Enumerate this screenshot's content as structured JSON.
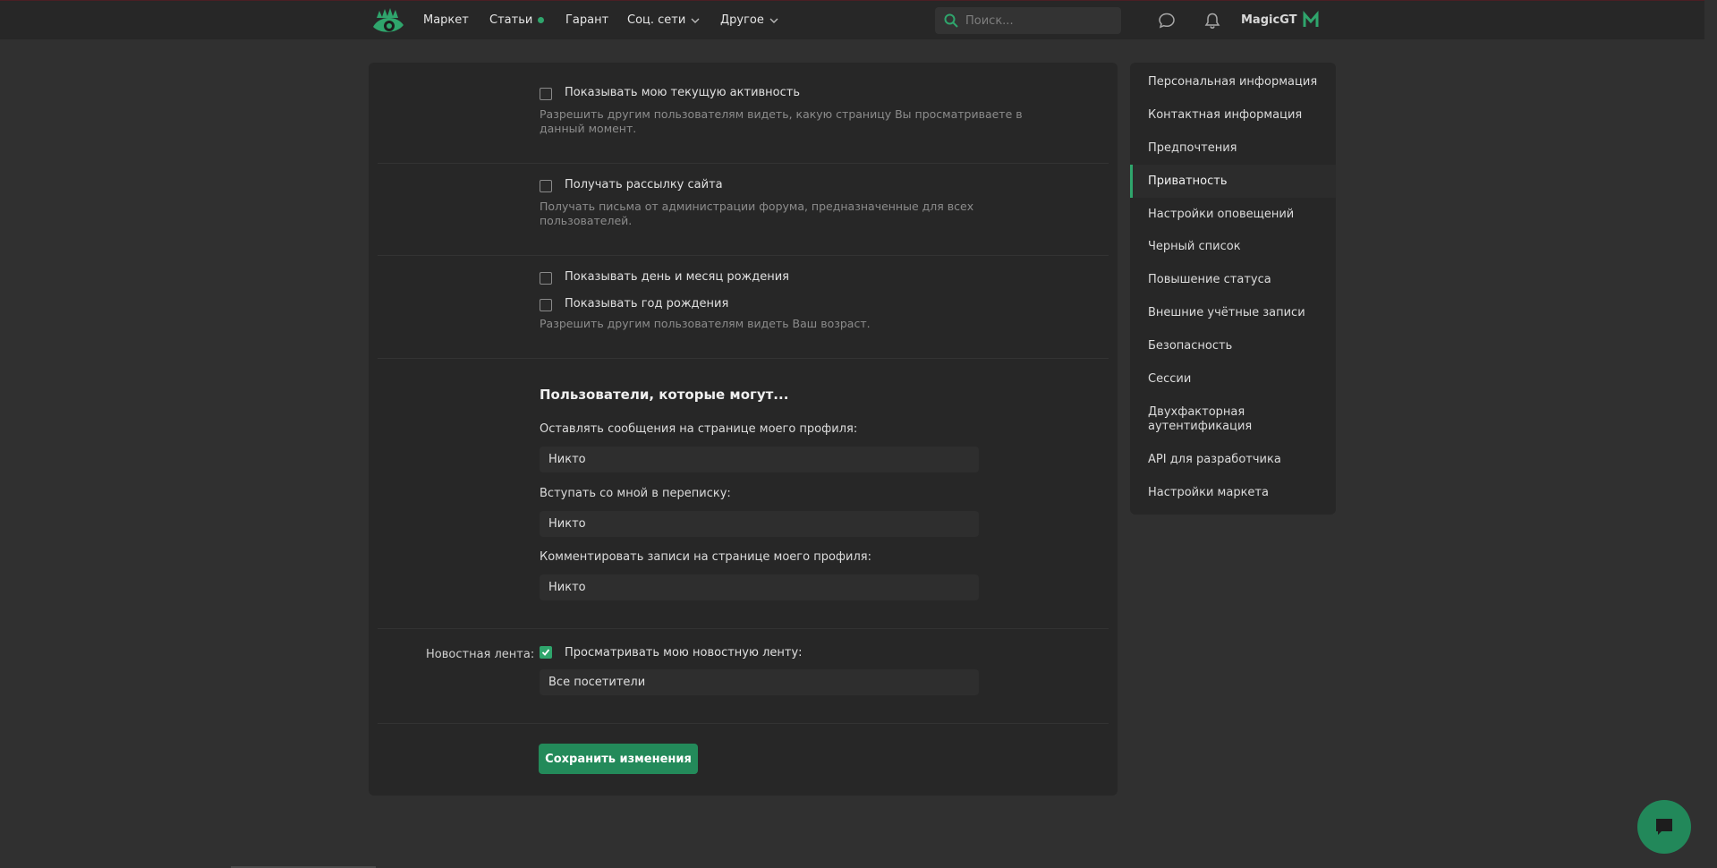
{
  "colors": {
    "accent": "#2fa56c",
    "background": "#303030",
    "panel": "#272727"
  },
  "header": {
    "nav": [
      {
        "label": "Маркет"
      },
      {
        "label": "Статьи"
      },
      {
        "label": "Гарант"
      },
      {
        "label": "Соц. сети"
      },
      {
        "label": "Другое"
      }
    ],
    "search_placeholder": "Поиск...",
    "username": "MagicGT",
    "icons": [
      "logo-icon",
      "search-icon",
      "chat-bubble-icon",
      "bell-icon",
      "avatar-icon"
    ]
  },
  "privacy": {
    "activity": {
      "label": "Показывать мою текущую активность",
      "hint": "Разрешить другим пользователям видеть, какую страницу Вы просматриваете в данный момент."
    },
    "newsletter": {
      "label": "Получать рассылку сайта",
      "hint": "Получать письма от администрации форума, предназначенные для всех пользователей."
    },
    "birthday_day": {
      "label": "Показывать день и месяц рождения"
    },
    "birthday_year": {
      "label": "Показывать год рождения",
      "hint": "Разрешить другим пользователям видеть Ваш возраст."
    },
    "users_can_title": "Пользователи, которые могут...",
    "profile_messages": {
      "label": "Оставлять сообщения на странице моего профиля:",
      "value": "Никто"
    },
    "conversations": {
      "label": "Вступать со мной в переписку:",
      "value": "Никто"
    },
    "comments": {
      "label": "Комментировать записи на странице моего профиля:",
      "value": "Никто"
    },
    "news_feed": {
      "row_label": "Новостная лента:",
      "label": "Просматривать мою новостную ленту:",
      "checked": true,
      "value": "Все посетители"
    },
    "save_label": "Сохранить изменения"
  },
  "sidebar": {
    "items": [
      {
        "label": "Персональная информация"
      },
      {
        "label": "Контактная информация"
      },
      {
        "label": "Предпочтения"
      },
      {
        "label": "Приватность"
      },
      {
        "label": "Настройки оповещений"
      },
      {
        "label": "Черный список"
      },
      {
        "label": "Повышение статуса"
      },
      {
        "label": "Внешние учётные записи"
      },
      {
        "label": "Безопасность"
      },
      {
        "label": "Сессии"
      },
      {
        "label": "Двухфакторная аутентификация"
      },
      {
        "label": "API для разработчика"
      },
      {
        "label": "Настройки маркета"
      }
    ],
    "active": "Приватность"
  }
}
